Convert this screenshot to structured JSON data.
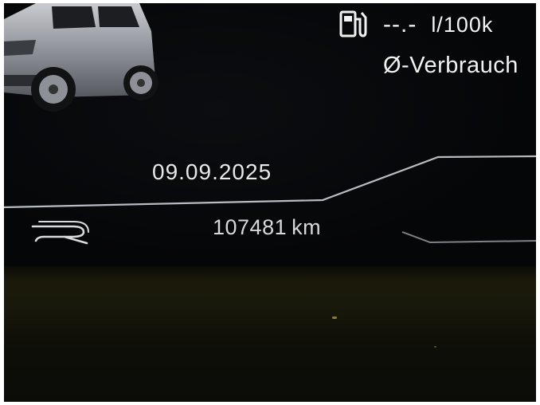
{
  "consumption": {
    "value": "--.-",
    "unit": "l/100k",
    "label": "Ø-Verbrauch",
    "icon": "fuel-pump-icon"
  },
  "trip": {
    "date": "09.09.2025",
    "odometer_value": "107481",
    "odometer_unit": "km"
  },
  "brand": {
    "icon": "r-logo-icon"
  },
  "colors": {
    "display_bg": "#050608",
    "text": "#f2f2f2",
    "line": "#b8bcc2",
    "dashboard_surface": "#1b1a0a"
  }
}
